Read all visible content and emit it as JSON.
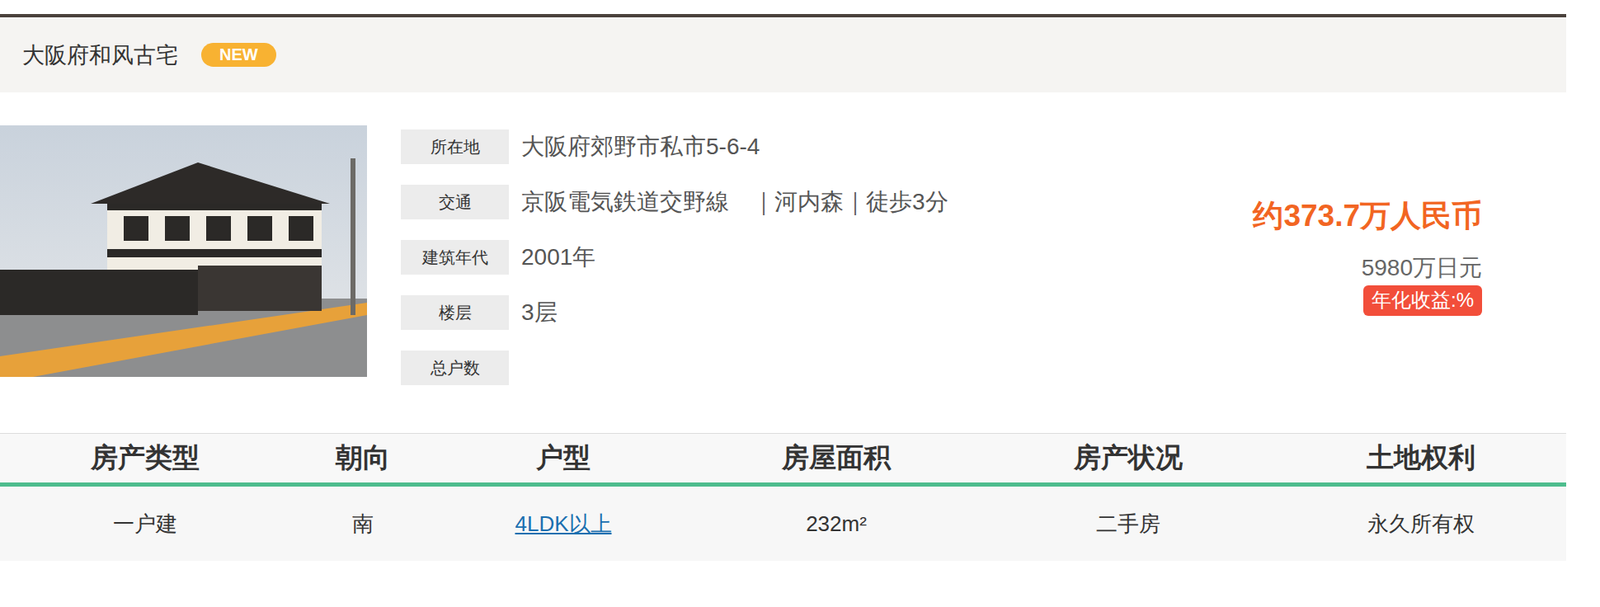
{
  "listing": {
    "title": "大阪府和风古宅",
    "badge": "NEW",
    "details": [
      {
        "label": "所在地",
        "value": "大阪府郊野市私市5-6-4"
      },
      {
        "label": "交通",
        "value": "京阪電気鉄道交野線　｜河内森｜徒歩3分"
      },
      {
        "label": "建筑年代",
        "value": "2001年"
      },
      {
        "label": "楼层",
        "value": "3层"
      },
      {
        "label": "总户数",
        "value": ""
      }
    ],
    "price": {
      "main": "约373.7万人民币",
      "yen": "5980万日元",
      "yield": "年化收益:%"
    }
  },
  "table": {
    "columns": [
      "房产类型",
      "朝向",
      "户型",
      "房屋面积",
      "房产状况",
      "土地权利"
    ],
    "row": [
      {
        "text": "一户建",
        "kind": "text"
      },
      {
        "text": "南",
        "kind": "text"
      },
      {
        "text": "4LDK以上",
        "kind": "link"
      },
      {
        "text": "232m²",
        "kind": "text"
      },
      {
        "text": "二手房",
        "kind": "text"
      },
      {
        "text": "永久所有权",
        "kind": "text"
      }
    ]
  }
}
